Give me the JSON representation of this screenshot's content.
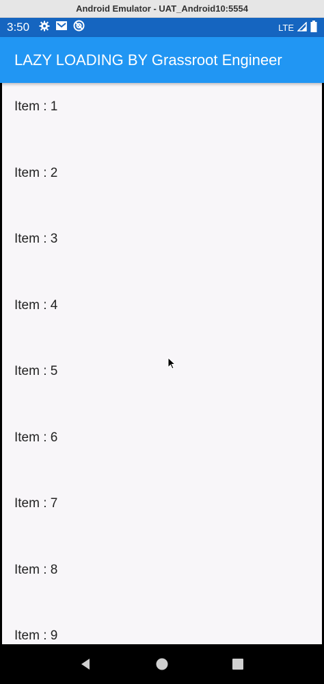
{
  "window": {
    "title": "Android Emulator - UAT_Android10:5554"
  },
  "status_bar": {
    "time": "3:50",
    "network": "LTE",
    "left_icons": [
      "gear-icon",
      "mail-icon",
      "sync-icon"
    ],
    "right_icons": [
      "signal-icon",
      "battery-icon"
    ]
  },
  "app_bar": {
    "title": "LAZY LOADING BY Grassroot Engineer"
  },
  "list": {
    "items": [
      {
        "label": "Item : 1"
      },
      {
        "label": "Item : 2"
      },
      {
        "label": "Item : 3"
      },
      {
        "label": "Item : 4"
      },
      {
        "label": "Item : 5"
      },
      {
        "label": "Item : 6"
      },
      {
        "label": "Item : 7"
      },
      {
        "label": "Item : 8"
      },
      {
        "label": "Item : 9"
      }
    ]
  },
  "nav_bar": {
    "buttons": [
      "back-icon",
      "home-icon",
      "recents-icon"
    ]
  },
  "colors": {
    "status_bar": "#1565c0",
    "app_bar": "#2196f3",
    "content_bg": "#f8f6f9",
    "nav_bar": "#000000"
  }
}
